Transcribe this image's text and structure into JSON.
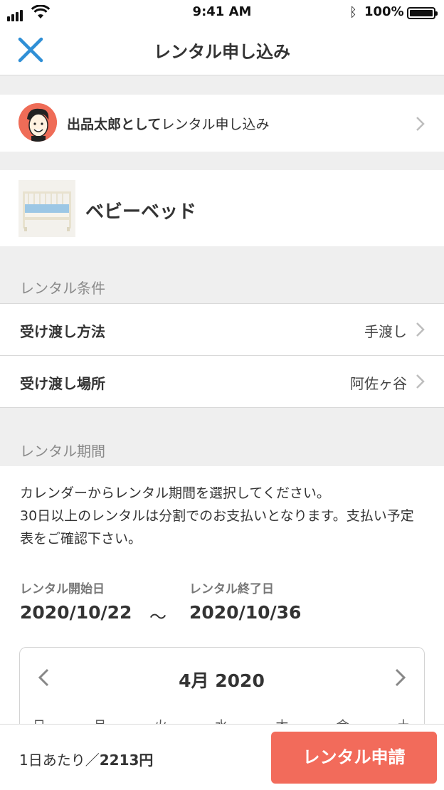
{
  "status_bar": {
    "time": "9:41 AM",
    "battery": "100%"
  },
  "nav": {
    "title": "レンタル申し込み"
  },
  "applicant": {
    "name_bold": "出品太郎として",
    "suffix": "レンタル申し込み"
  },
  "product": {
    "name": "ベビーベッド"
  },
  "conditions": {
    "section_label": "レンタル条件",
    "rows": [
      {
        "label": "受け渡し方法",
        "value": "手渡し"
      },
      {
        "label": "受け渡し場所",
        "value": "阿佐ヶ谷"
      }
    ]
  },
  "period": {
    "section_label": "レンタル期間",
    "desc_line1": "カレンダーからレンタル期間を選択してください。",
    "desc_line2": "30日以上のレンタルは分割でのお支払いとなります。支払い予定表をご確認下さい。",
    "start_label": "レンタル開始日",
    "start_value": "2020/10/22",
    "separator": "〜",
    "end_label": "レンタル終了日",
    "end_value": "2020/10/36"
  },
  "calendar": {
    "month_label": "4月 2020",
    "weekdays": [
      "日",
      "月",
      "火",
      "水",
      "木",
      "金",
      "土"
    ]
  },
  "footer": {
    "price_prefix": "1日あたり／",
    "price_value": "2213円",
    "apply_label": "レンタル申請"
  },
  "colors": {
    "accent": "#f26b5b",
    "close_icon": "#2f8fd6",
    "background": "#efefef"
  }
}
